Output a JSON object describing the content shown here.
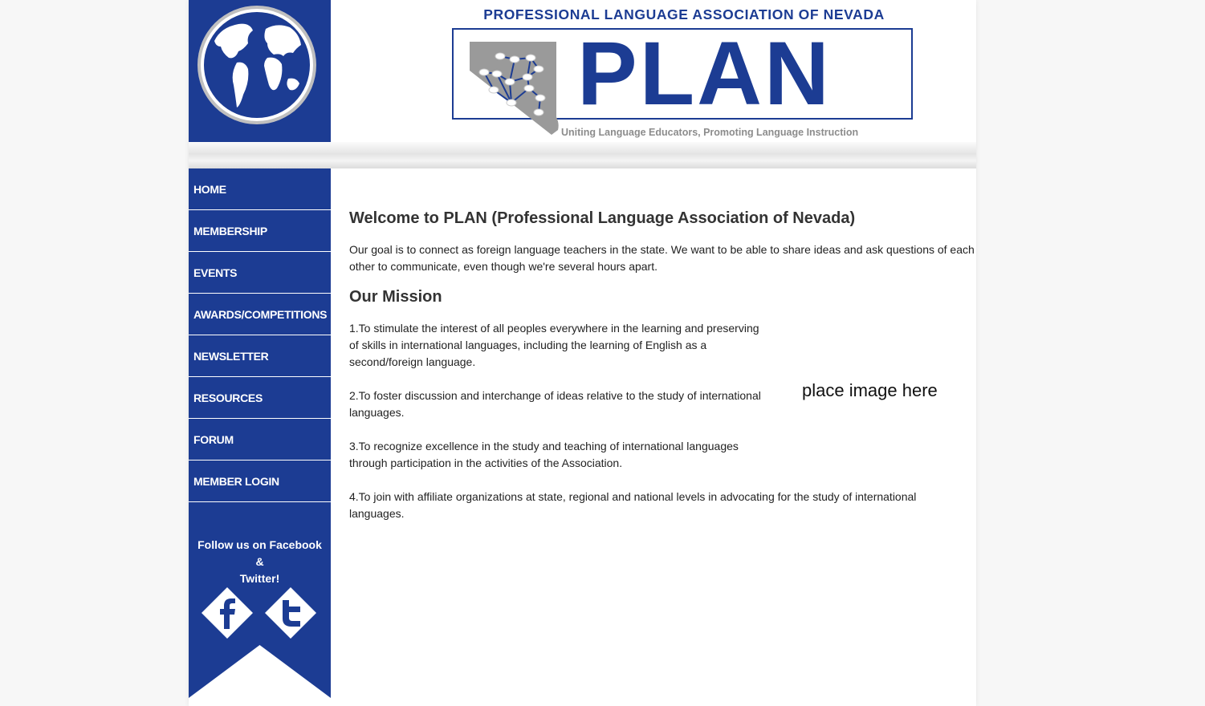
{
  "colors": {
    "brand_blue": "#1c3c93",
    "logo_grey": "#8c8c8c"
  },
  "header": {
    "association_name": "PROFESSIONAL LANGUAGE ASSOCIATION OF NEVADA",
    "logo_word": "PLAN",
    "tagline": "Uniting Language Educators, Promoting Language Instruction"
  },
  "nav": {
    "items": [
      {
        "label": "HOME"
      },
      {
        "label": "MEMBERSHIP"
      },
      {
        "label": "EVENTS"
      },
      {
        "label": "AWARDS/COMPETITIONS"
      },
      {
        "label": "NEWSLETTER"
      },
      {
        "label": "RESOURCES"
      },
      {
        "label": "FORUM"
      },
      {
        "label": "MEMBER LOGIN"
      }
    ]
  },
  "social": {
    "follow_line1": "Follow us on Facebook",
    "follow_line2": "&",
    "follow_line3": "Twitter!",
    "icons": [
      "facebook-icon",
      "twitter-icon"
    ]
  },
  "main": {
    "heading": "Welcome to PLAN (Professional Language Association of Nevada)",
    "intro": "Our goal is to connect as foreign language teachers in the state. We want to be able to share ideas and ask questions of each other to communicate, even though we're several hours apart.",
    "mission_heading": "Our Mission",
    "mission_items": [
      "1.To stimulate the interest of all peoples everywhere in the learning and preserving of skills in international languages, including the learning of English as a second/foreign language.",
      "2.To foster discussion and interchange of ideas relative to the study of international languages.",
      "3.To recognize excellence in the study and teaching of international languages through participation in the activities of the Association.",
      "4.To join with affiliate organizations at state, regional and national levels in advocating for the study of international languages."
    ],
    "image_placeholder": "place image here"
  }
}
